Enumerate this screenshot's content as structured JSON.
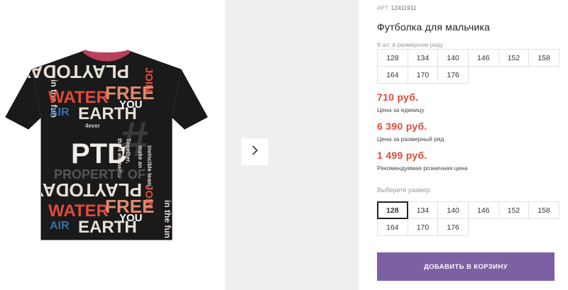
{
  "product": {
    "article_label": "АРТ.",
    "article_number": "12411911",
    "title": "Футболка для мальчика",
    "pack_note": "9 шт. в размерном ряду",
    "pack_sizes": [
      "128",
      "134",
      "140",
      "146",
      "152",
      "158",
      "164",
      "170",
      "176"
    ]
  },
  "prices": [
    {
      "value": "710 руб.",
      "label": "Цена за единицу"
    },
    {
      "value": "6 390 руб.",
      "label": "Цена за размерный ряд"
    },
    {
      "value": "1 499 руб.",
      "label": "Рекомендуемая розничная цена"
    }
  ],
  "size_select": {
    "label": "Выберите размер:",
    "options": [
      "128",
      "134",
      "140",
      "146",
      "152",
      "158",
      "164",
      "170",
      "176"
    ],
    "selected": "128"
  },
  "cart_button": {
    "label": "ДОБАВИТЬ В КОРЗИНУ"
  },
  "gallery": {
    "next_icon": "chevron-right-icon"
  },
  "colors": {
    "price_red": "#e04a3b",
    "button_purple": "#7d5fa3",
    "shirt_black": "#1a1a1a",
    "collar_red": "#b8405a"
  },
  "shirt_print": {
    "words": [
      "WATER",
      "FREE",
      "EARTH",
      "YOU",
      "AIR",
      "JOIN",
      "in the fun",
      "Together,",
      "the 4 elements",
      "make an",
      "invincible team.",
      "PROPERTY OF",
      "PLAYTODAY",
      "4ever",
      "PTD"
    ]
  }
}
